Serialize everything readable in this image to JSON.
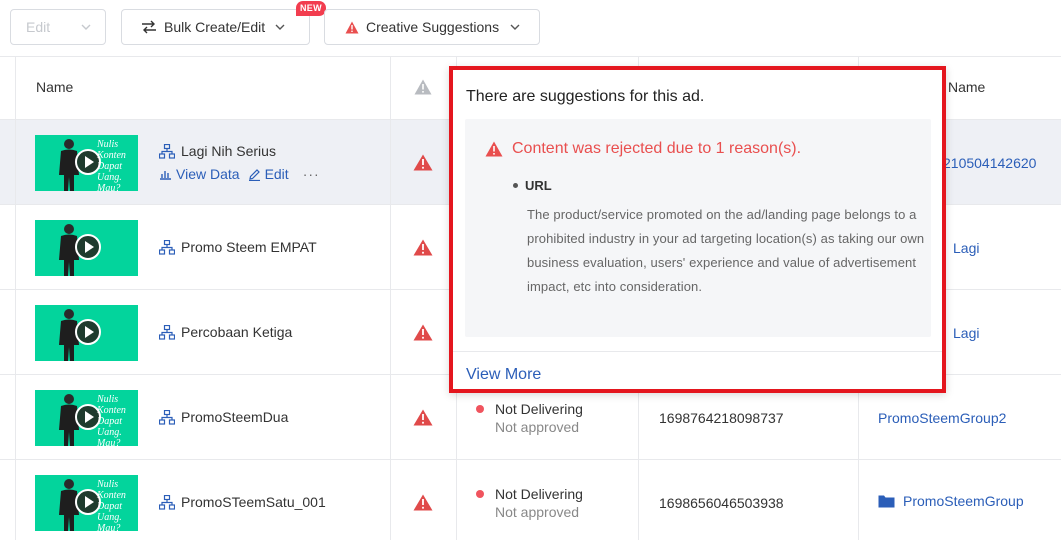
{
  "toolbar": {
    "edit_label": "Edit",
    "bulk_label": "Bulk Create/Edit",
    "new_badge": "NEW",
    "suggestions_label": "Creative Suggestions"
  },
  "table": {
    "headers": {
      "name": "Name",
      "ad_group_name": "Name"
    },
    "rows": [
      {
        "name": "Lagi Nih Serius",
        "thumb_text": "Nulis Konten Dapat Uang. Mau?",
        "status": "",
        "status_sub": "",
        "ad_id": "",
        "group": "210504142620",
        "view_data": "View Data",
        "edit": "Edit",
        "more": "···"
      },
      {
        "name": "Promo Steem EMPAT",
        "thumb_text": "",
        "status": "",
        "status_sub": "",
        "ad_id": "",
        "group": "Lagi"
      },
      {
        "name": "Percobaan Ketiga",
        "thumb_text": "",
        "status": "",
        "status_sub": "",
        "ad_id": "",
        "group": "Lagi"
      },
      {
        "name": "PromoSteemDua",
        "thumb_text": "Nulis Konten Dapat Uang. Mau?",
        "status": "Not Delivering",
        "status_sub": "Not approved",
        "ad_id": "1698764218098737",
        "group": "PromoSteemGroup2"
      },
      {
        "name": "PromoSTeemSatu_001",
        "thumb_text": "Nulis Konten Dapat Uang. Mau?",
        "status": "Not Delivering",
        "status_sub": "Not approved",
        "ad_id": "1698656046503938",
        "group": "PromoSteemGroup"
      }
    ]
  },
  "popover": {
    "title": "There are suggestions for this ad.",
    "rejection": "Content was rejected due to 1 reason(s).",
    "reason_title": "URL",
    "reason_desc": "The product/service promoted on the ad/landing page belongs to a prohibited industry in your ad targeting location(s) as taking our own business evaluation, users' experience and value of advertisement impact, etc into consideration.",
    "view_more": "View More"
  },
  "colors": {
    "accent_link": "#2b5eb8",
    "warning_red": "#e94f4f",
    "thumb_green": "#03d49c",
    "highlight_border": "#e4161e"
  }
}
